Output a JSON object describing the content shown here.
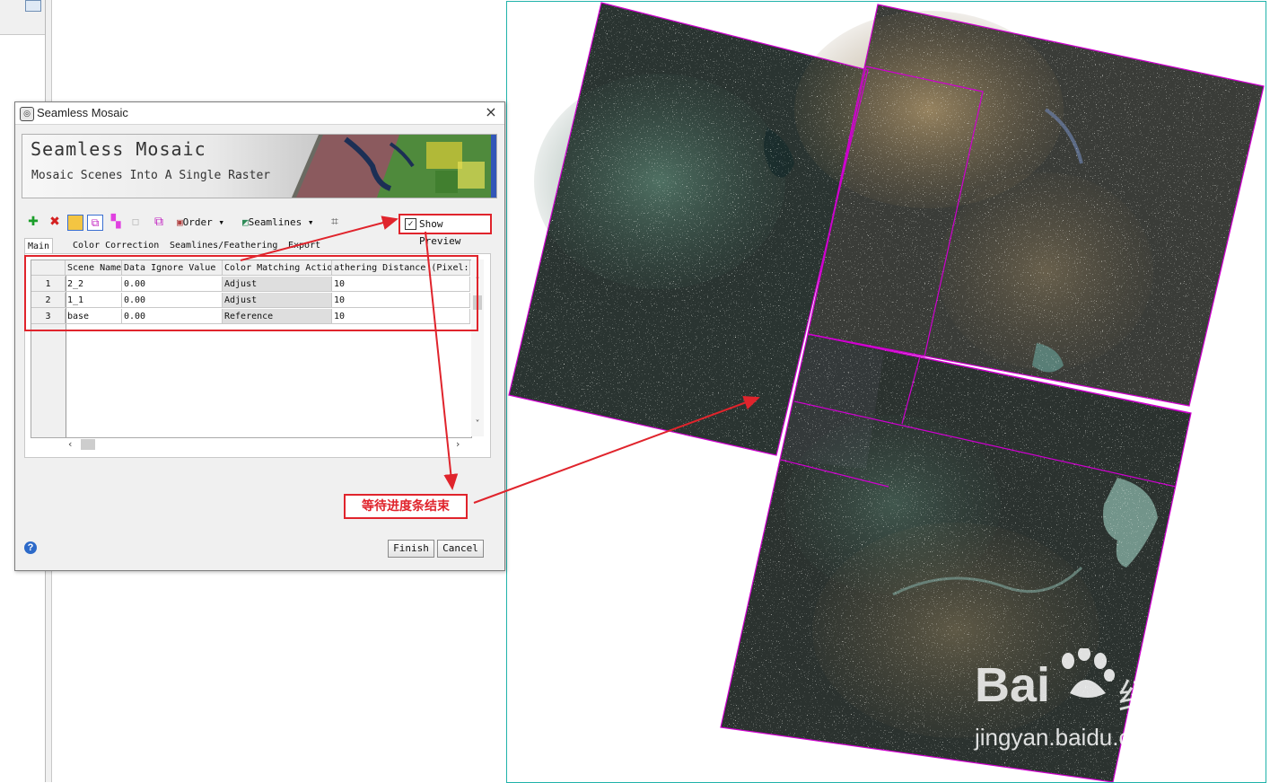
{
  "dialog": {
    "title": "Seamless Mosaic",
    "close_glyph": "×",
    "banner_title": "Seamless Mosaic",
    "banner_subtitle": "Mosaic Scenes Into A Single Raster"
  },
  "toolbar": {
    "order_label": "Order",
    "seamlines_label": "Seamlines",
    "show_preview_label": "Show Preview",
    "show_preview_checked": true,
    "icons": [
      "add-icon",
      "delete-icon",
      "color-pair-icon",
      "footprint-icon",
      "stack-icon",
      "disabled-icon",
      "seamline-edit-icon",
      "order-icon",
      "seamlines-icon",
      "crop-icon"
    ]
  },
  "tabs": [
    "Main",
    "Color Correction",
    "Seamlines/Feathering",
    "Export"
  ],
  "table": {
    "columns": [
      "Scene Name",
      "Data Ignore Value",
      "Color Matching Action",
      "Feathering Distance (Pixels)"
    ],
    "column_display": [
      "Scene Name",
      "Data Ignore Value",
      "Color Matching Actio",
      "athering Distance (Pixel:"
    ],
    "rows": [
      {
        "num": "1",
        "scene": "2_2",
        "ignore": "0.00",
        "action": "Adjust",
        "distance": "10"
      },
      {
        "num": "2",
        "scene": "1_1",
        "ignore": "0.00",
        "action": "Adjust",
        "distance": "10"
      },
      {
        "num": "3",
        "scene": "base",
        "ignore": "0.00",
        "action": "Reference",
        "distance": "10"
      }
    ]
  },
  "callout_text": "等待进度条结束",
  "buttons": {
    "finish": "Finish",
    "cancel": "Cancel",
    "help": "?"
  },
  "watermark": {
    "brand": "Bai",
    "brand_cn": "经验",
    "url": "jingyan.baidu.com"
  },
  "colors": {
    "annotation_red": "#e0242c",
    "footprint_magenta": "#d000d0",
    "frame_teal": "#20b2aa"
  }
}
